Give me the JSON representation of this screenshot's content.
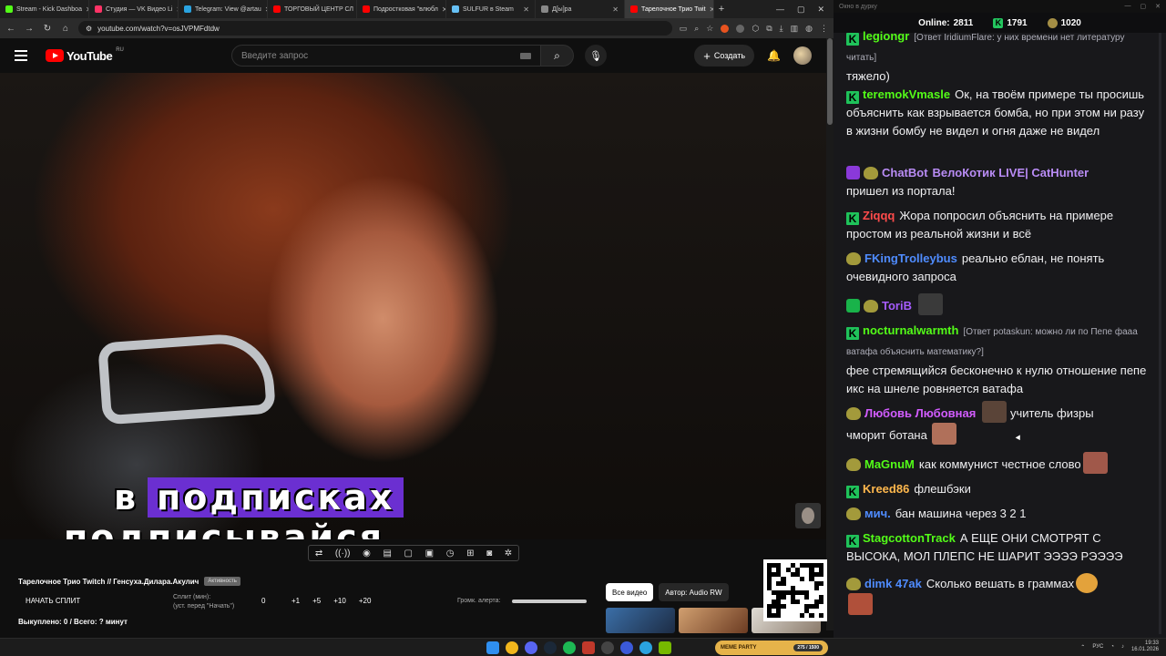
{
  "browser": {
    "tabs": [
      {
        "title": "Stream - Kick Dashboa",
        "color": "#53fc18",
        "active": false
      },
      {
        "title": "Студия — VK Видео Li",
        "color": "#ff3366",
        "active": false
      },
      {
        "title": "Telegram: View @artau",
        "color": "#2aa3e0",
        "active": false
      },
      {
        "title": "ТОРГОВЫЙ ЦЕНТР СЛ",
        "color": "#ff0000",
        "active": false
      },
      {
        "title": "Подростковая \"влюбл",
        "color": "#ff0000",
        "active": false
      },
      {
        "title": "SULFUR в Steam",
        "color": "#66c0f4",
        "active": false
      },
      {
        "title": "Д[ы]ра",
        "color": "#888888",
        "active": false
      },
      {
        "title": "Тарелочное Трио Twit",
        "color": "#ff0000",
        "active": true
      }
    ],
    "new_tab": "+",
    "url": "youtube.com/watch?v=osJVPMFdtdw"
  },
  "youtube": {
    "logo_text": "YouTube",
    "region": "RU",
    "search_placeholder": "Введите запрос",
    "create_label": "Создать"
  },
  "video": {
    "caption_word1": "в",
    "caption_word2": "подписках",
    "caption_line2": "подписывайся"
  },
  "panel": {
    "toolstrip_icons": [
      "⇄",
      "((·))",
      "◉",
      "▤",
      "▢",
      "▣",
      "◷",
      "⊞",
      "◙",
      "✲"
    ],
    "stream_title": "Тарелочное Трио Twitch // Генсуха.Дилара.Акулич",
    "stream_badge": "Активность",
    "start_split": "НАЧАТЬ СПЛИТ",
    "split_label": "Сплит (мин):",
    "split_hint": "(уст. перед \"Начать\")",
    "split_value": "0",
    "plus_buttons": [
      "+1",
      "+5",
      "+10",
      "+20"
    ],
    "alert_label": "Громк. алерта:",
    "alert_level": 1.0,
    "bought": "Выкуплено: 0 / Всего: ? минут",
    "btn_all_videos": "Все видео",
    "btn_author": "Автор: Audio RW"
  },
  "chat": {
    "window_title": "Окно в дурку",
    "online_label": "Online:",
    "online_count": "2811",
    "kick_count": "1791",
    "coin_count": "1020",
    "messages": [
      {
        "user": "legiongr",
        "color": "#53fc18",
        "reply": "[Ответ IridiumFlare: у них времени нет литературу читать]",
        "text": "тяжело)"
      },
      {
        "user": "teremokVmasle",
        "color": "#53fc18",
        "text": "Ок, на твоём примере ты просишь объяснить как взрывается бомба, но при этом ни разу в жизни бомбу не видел и огня даже не видел"
      },
      {
        "user": "ChatBot",
        "color": "#b98cf5",
        "text": "ВелоКотик LIVE| CatHunter",
        "text2": "пришел из портала!"
      },
      {
        "user": "Ziqqq",
        "color": "#ff4b4b",
        "text": "Жора попросил объяснить на примере простом из реальной жизни и всё"
      },
      {
        "user": "FKingTrolleybus",
        "color": "#4f8cff",
        "text": "реально еблан, не понять очевидного запроса"
      },
      {
        "user": "ToriB",
        "color": "#a65cff",
        "text": ""
      },
      {
        "user": "nocturnalwarmth",
        "color": "#53fc18",
        "reply": "[Ответ potaskun: можно ли по Пепе фааа ватафа объяснить математику?]",
        "text": "фее стремящийся бесконечно к нулю отношение пепе икс на шнеле ровняется ватафа"
      },
      {
        "user": "Любовь Любовная",
        "color": "#d25cff",
        "text": "учитель физры",
        "text2": "чморит ботана"
      },
      {
        "user": "MaGnuM",
        "color": "#53fc18",
        "text": "как коммунист честное слово"
      },
      {
        "user": "Kreed86",
        "color": "#ffb84d",
        "text": "флешбэки"
      },
      {
        "user": "мич.",
        "color": "#4f8cff",
        "text": "бан машина через 3 2 1"
      },
      {
        "user": "StagcottonTrack",
        "color": "#53fc18",
        "text": "А ЕЩЕ ОНИ СМОТРЯТ С ВЫСОКА, МОЛ ПЛЕПС НЕ ШАРИТ ЭЭЭЭ РЭЭЭЭ"
      },
      {
        "user": "dimk 47ak",
        "color": "#4f8cff",
        "text": "Сколько вешать в граммах"
      }
    ]
  },
  "taskbar": {
    "kick_pill_label": "MEME PARTY",
    "kick_pill_count": "275 / 1500",
    "lang": "РУС",
    "time": "19:33",
    "date": "16.01.2026"
  }
}
